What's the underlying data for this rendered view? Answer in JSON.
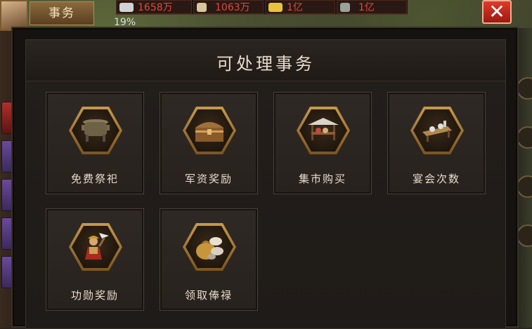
{
  "topbar": {
    "tab_label": "事务",
    "resources": [
      {
        "icon": "silver-ingot-icon",
        "value": "1658万"
      },
      {
        "icon": "grain-icon",
        "value": "1063万"
      },
      {
        "icon": "gold-bar-icon",
        "value": "1亿"
      },
      {
        "icon": "soldier-icon",
        "value": "1亿"
      }
    ],
    "percent": "19%",
    "close_label": "✕"
  },
  "panel": {
    "title": "可处理事务",
    "items": [
      {
        "label": "免费祭祀",
        "icon": "incense-burner-icon"
      },
      {
        "label": "军资奖励",
        "icon": "treasure-chest-icon"
      },
      {
        "label": "集市购买",
        "icon": "market-stall-icon"
      },
      {
        "label": "宴会次数",
        "icon": "banquet-table-icon"
      },
      {
        "label": "功勋奖励",
        "icon": "general-warrior-icon"
      },
      {
        "label": "领取俸禄",
        "icon": "money-bag-icon"
      }
    ]
  },
  "colors": {
    "resource_text": "#e04a3a",
    "close_button": "#d03020",
    "hex_frame": "#c89a48",
    "label_text": "#e8dccc"
  }
}
